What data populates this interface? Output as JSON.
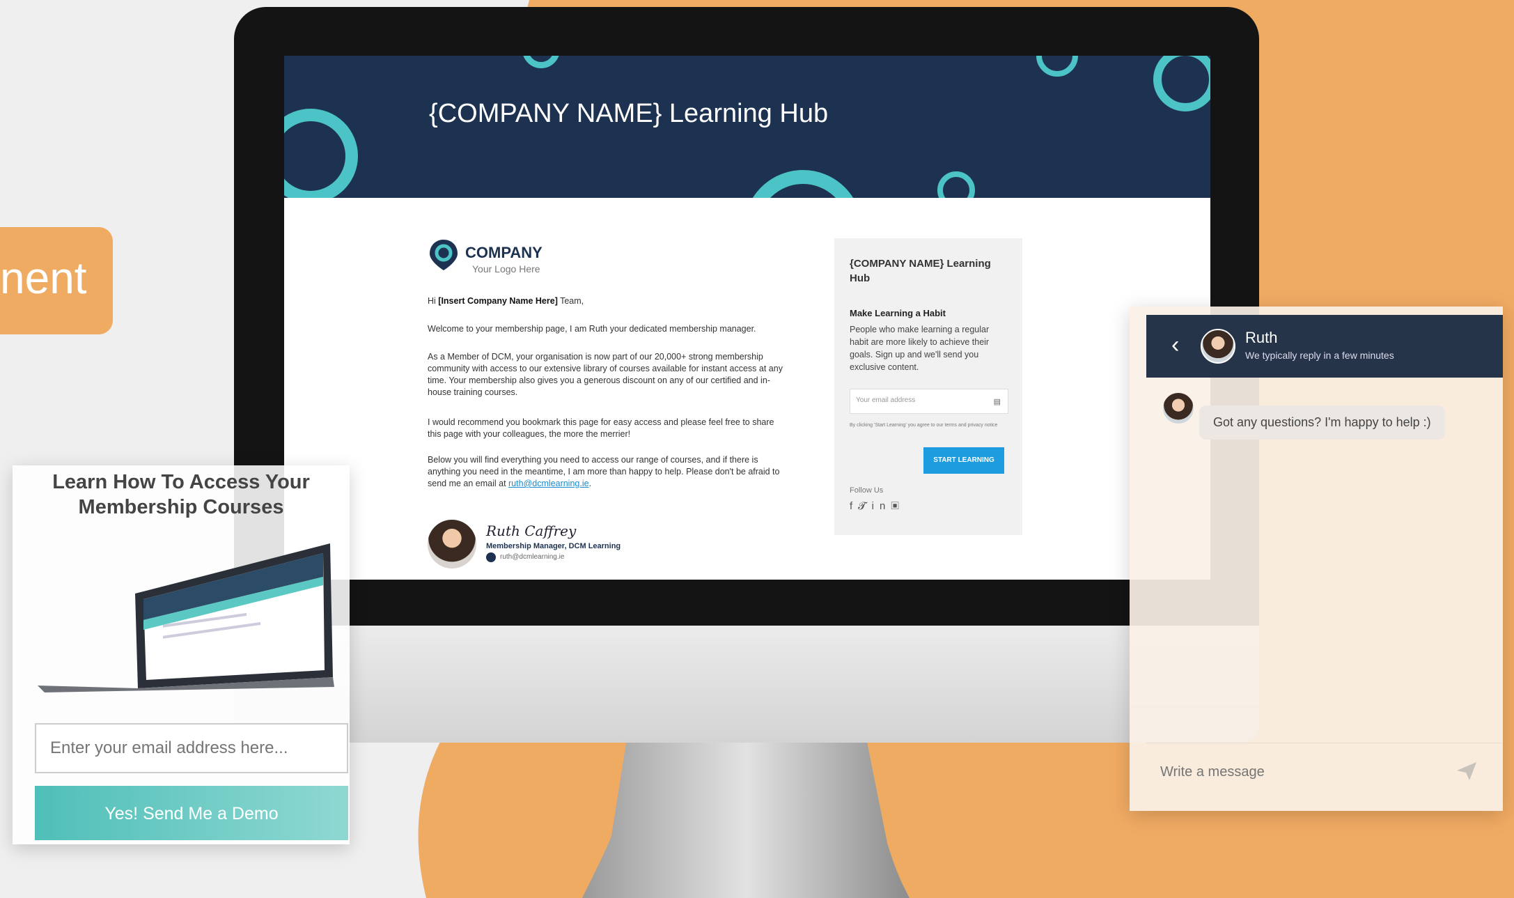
{
  "left_tab": {
    "label": "nent"
  },
  "hub": {
    "title": "{COMPANY NAME} Learning Hub"
  },
  "company_logo": {
    "name": "COMPANY",
    "sub": "Your Logo Here"
  },
  "letter": {
    "greeting_prefix": "Hi ",
    "greeting_name": "[Insert Company Name Here]",
    "greeting_suffix": " Team,",
    "p1": "Welcome to your membership page, I am Ruth your dedicated membership manager.",
    "p2": "As a Member of DCM, your organisation is now part of our 20,000+ strong membership community with access to our extensive library of courses available for instant access at any time. Your membership also gives you a generous discount on any of our certified and in-house training courses.",
    "p3": "I would recommend you bookmark this page for easy access and please feel free to share this page with your colleagues, the more the merrier!",
    "p4": "Below you will find everything you need to access our range of courses, and if there is anything you need in the meantime, I am more than happy to help. Please don't be afraid to send me an email at ",
    "email": "ruth@dcmlearning.ie",
    "p4_end": ".",
    "signature": "Ruth Caffrey",
    "role": "Membership Manager, DCM Learning",
    "role_email": "ruth@dcmlearning.ie"
  },
  "signup_card": {
    "title": "{COMPANY NAME} Learning Hub",
    "heading": "Make Learning a Habit",
    "body": "People who make learning a regular habit are more likely to achieve their goals. Sign up and we'll send you exclusive content.",
    "email_placeholder": "Your email address",
    "fine_print": "By clicking 'Start Learning' you agree to our terms and privacy notice",
    "button": "START LEARNING",
    "follow": "Follow Us"
  },
  "demo_card": {
    "title_line1": "Learn How To Access Your",
    "title_line2": "Membership Courses",
    "email_placeholder": "Enter your email address here...",
    "button": "Yes! Send Me a Demo"
  },
  "chat": {
    "name": "Ruth",
    "subtitle": "We typically reply in a few minutes",
    "message": "Got any questions? I'm happy to help :)",
    "input_placeholder": "Write a message"
  },
  "colors": {
    "orange": "#f0ab63",
    "navy": "#1d3251",
    "teal": "#4cc3c6",
    "button_blue": "#1e9ce0",
    "demo_button": "#4fbfb8"
  }
}
